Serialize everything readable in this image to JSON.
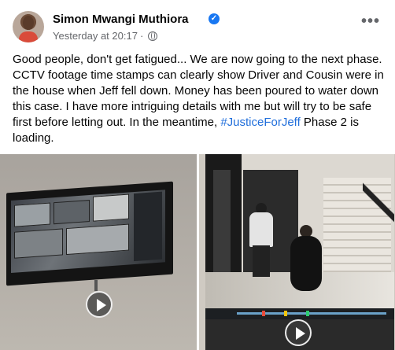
{
  "post": {
    "author": "Simon Mwangi Muthiora",
    "timestamp": "Yesterday at 20:17",
    "separator": "·",
    "more": "•••",
    "text_main": "Good people, don't get fatigued... We are now going to the next phase. CCTV footage time stamps can clearly show Driver and Cousin were in the house when Jeff fell down. Money has been poured to water down this case. I have more intriguing details with me but will try to be safe first before letting out. In the meantime, ",
    "hashtag": "#JusticeForJeff",
    "text_end": " Phase 2 is loading."
  },
  "icons": {
    "verified": "verified-badge-icon",
    "privacy": "globe-icon",
    "more": "more-options-icon",
    "play": "play-icon"
  },
  "colors": {
    "accent": "#1877f2",
    "hashtag": "#216fdb",
    "secondary_text": "#65676b"
  }
}
